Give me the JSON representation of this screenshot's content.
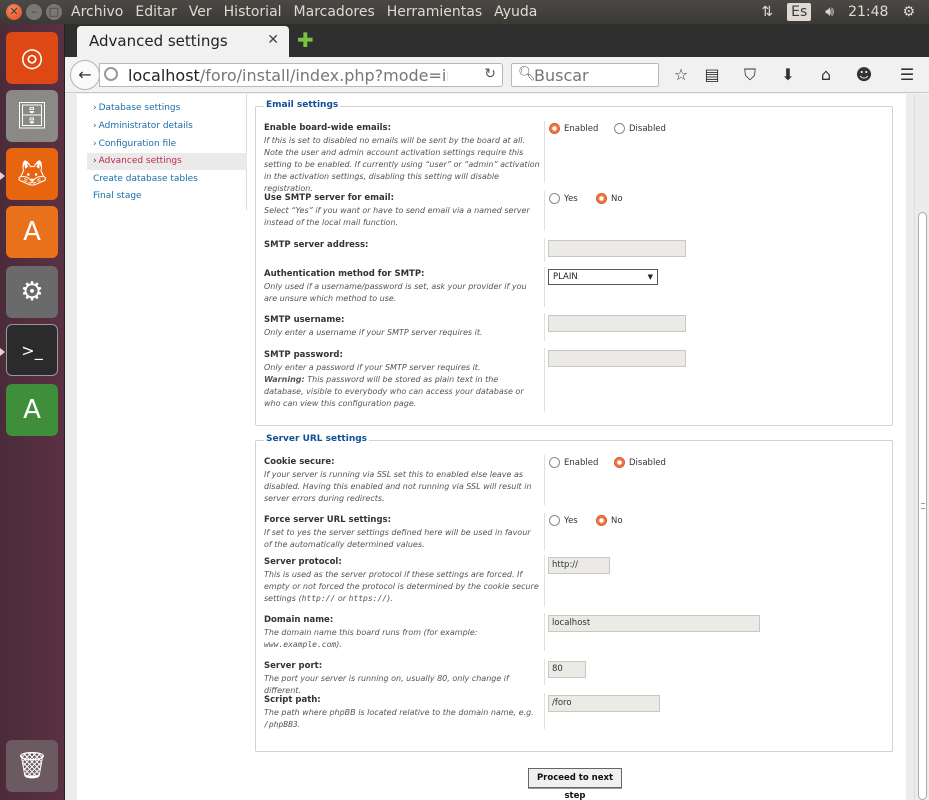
{
  "top_panel": {
    "menu": [
      "Archivo",
      "Editar",
      "Ver",
      "Historial",
      "Marcadores",
      "Herramientas",
      "Ayuda"
    ],
    "keyboard_layout": "Es",
    "clock": "21:48"
  },
  "launcher": {
    "items": [
      "ubuntu-dash-icon",
      "files-icon",
      "firefox-icon",
      "software-center-icon",
      "system-settings-icon",
      "terminal-icon",
      "software-updater-icon",
      "trash-icon"
    ]
  },
  "browser": {
    "tab_title": "Advanced settings",
    "url_host": "localhost",
    "url_path": "/foro/install/index.php?mode=install&",
    "search_placeholder": "Buscar"
  },
  "sidebar": {
    "items": [
      {
        "label": "Database settings"
      },
      {
        "label": "Administrator details"
      },
      {
        "label": "Configuration file"
      },
      {
        "label": "Advanced settings"
      },
      {
        "label": "Create database tables"
      },
      {
        "label": "Final stage"
      }
    ]
  },
  "email": {
    "legend": "Email settings",
    "board_emails": {
      "label": "Enable board-wide emails:",
      "desc": "If this is set to disabled no emails will be sent by the board at all. Note the user and admin account activation settings require this setting to be enabled. If currently using “user” or “admin” activation in the activation settings, disabling this setting will disable registration.",
      "opt1": "Enabled",
      "opt2": "Disabled"
    },
    "smtp": {
      "label": "Use SMTP server for email:",
      "desc": "Select “Yes” if you want or have to send email via a named server instead of the local mail function.",
      "opt1": "Yes",
      "opt2": "No"
    },
    "smtp_address": {
      "label": "SMTP server address:",
      "value": ""
    },
    "smtp_auth": {
      "label": "Authentication method for SMTP:",
      "desc": "Only used if a username/password is set, ask your provider if you are unsure which method to use.",
      "value": "PLAIN"
    },
    "smtp_user": {
      "label": "SMTP username:",
      "desc": "Only enter a username if your SMTP server requires it.",
      "value": ""
    },
    "smtp_pass": {
      "label": "SMTP password:",
      "desc": "Only enter a password if your SMTP server requires it.",
      "warning_label": "Warning:",
      "warning": "This password will be stored as plain text in the database, visible to everybody who can access your database or who can view this configuration page.",
      "value": ""
    }
  },
  "server": {
    "legend": "Server URL settings",
    "cookie_secure": {
      "label": "Cookie secure:",
      "desc": "If your server is running via SSL set this to enabled else leave as disabled. Having this enabled and not running via SSL will result in server errors during redirects.",
      "opt1": "Enabled",
      "opt2": "Disabled"
    },
    "force_url": {
      "label": "Force server URL settings:",
      "desc": "If set to yes the server settings defined here will be used in favour of the automatically determined values.",
      "opt1": "Yes",
      "opt2": "No"
    },
    "protocol": {
      "label": "Server protocol:",
      "desc": "This is used as the server protocol if these settings are forced. If empty or not forced the protocol is determined by the cookie secure settings",
      "code1": "http://",
      "or": "or",
      "code2": "https://",
      "end": ").",
      "value": "http://"
    },
    "domain": {
      "label": "Domain name:",
      "desc": "The domain name this board runs from (for example:",
      "code": "www.example.com",
      "end": ").",
      "value": "localhost"
    },
    "port": {
      "label": "Server port:",
      "desc": "The port your server is running on, usually 80, only change if different.",
      "value": "80"
    },
    "script_path": {
      "label": "Script path:",
      "desc": "The path where phpBB is located relative to the domain name, e.g.",
      "code": "/phpBB3",
      "end": ".",
      "value": "/foro"
    }
  },
  "proceed_label": "Proceed to next step"
}
